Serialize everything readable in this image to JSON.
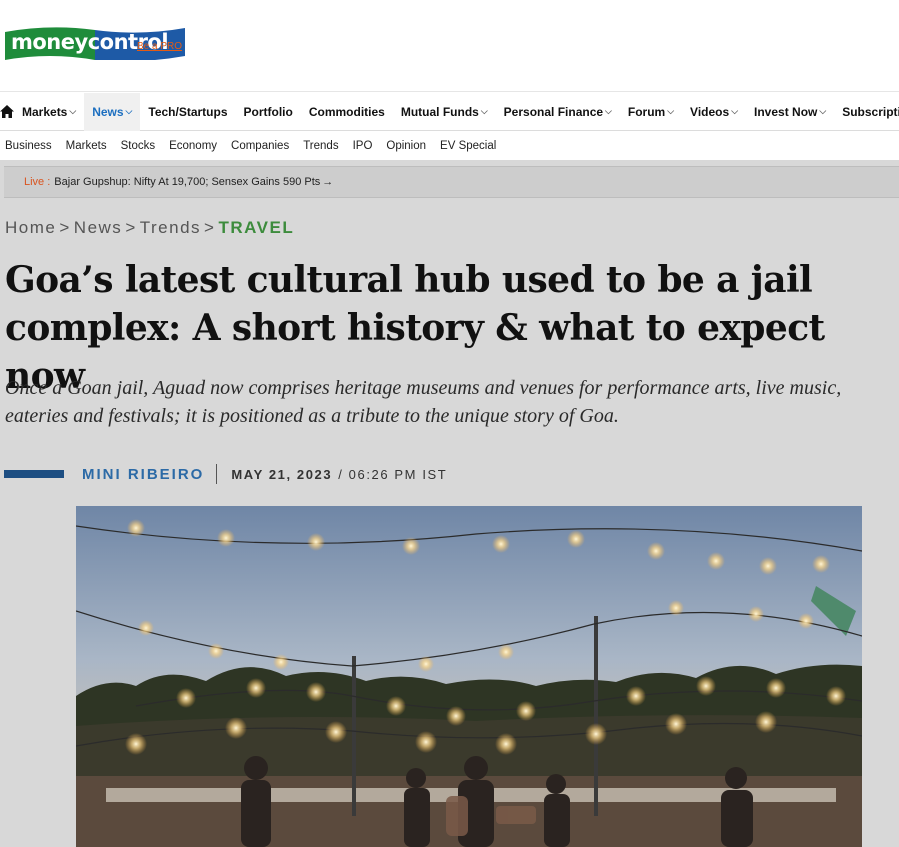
{
  "brand": {
    "logo_text": "moneycontrol",
    "logo_colors": {
      "money": "#1f8c3b",
      "control": "#1e5aa6"
    },
    "pro_link": "Be a PRO"
  },
  "main_nav": {
    "home_icon": "home-icon",
    "items": [
      {
        "label": "Markets",
        "chevron": true
      },
      {
        "label": "News",
        "chevron": true,
        "active": true
      },
      {
        "label": "Tech/Startups",
        "chevron": false
      },
      {
        "label": "Portfolio",
        "chevron": false
      },
      {
        "label": "Commodities",
        "chevron": false
      },
      {
        "label": "Mutual Funds",
        "chevron": true
      },
      {
        "label": "Personal Finance",
        "chevron": true
      },
      {
        "label": "Forum",
        "chevron": true
      },
      {
        "label": "Videos",
        "chevron": true
      },
      {
        "label": "Invest Now",
        "chevron": true
      },
      {
        "label": "Subscriptio",
        "chevron": false
      }
    ]
  },
  "sub_nav": [
    "Business",
    "Markets",
    "Stocks",
    "Economy",
    "Companies",
    "Trends",
    "IPO",
    "Opinion",
    "EV Special"
  ],
  "live": {
    "label": "Live :",
    "text": "Bajar Gupshup: Nifty At 19,700; Sensex Gains 590 Pts",
    "arrow": "→"
  },
  "breadcrumb": {
    "items": [
      "Home",
      "News",
      "Trends"
    ],
    "current": "TRAVEL",
    "separator": ">"
  },
  "article": {
    "headline": "Goa’s latest cultural hub used to be a jail complex: A short history & what to expect now",
    "summary": "Once a Goan jail, Aguad now comprises heritage museums and venues for performance arts, live music, eateries and festivals; it is positioned as a tribute to the unique story of Goa.",
    "author": "MINI RIBEIRO",
    "date": "MAY 21, 2023",
    "time": "/ 06:26 PM IST"
  },
  "colors": {
    "accent_blue": "#1d6fc0",
    "travel_green": "#3d8c3d",
    "live_orange": "#d9531e",
    "byline_bar": "#1d4e82"
  }
}
